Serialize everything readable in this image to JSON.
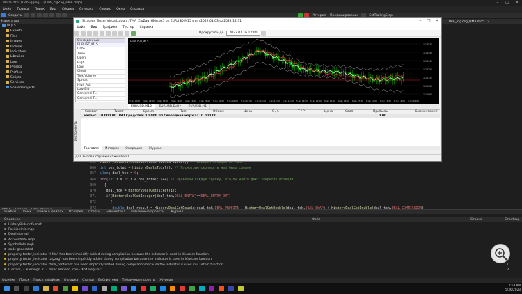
{
  "app": {
    "title": "MetaEditor (Debugging) - [TMA_ZigZag_HMA.mq5]"
  },
  "menu": [
    "Файл",
    "Правка",
    "Поиск",
    "Вид",
    "Сборка",
    "Отладка",
    "Сервис",
    "Окно",
    "Справка"
  ],
  "toolbar": {
    "new_label": "Создать",
    "compile_label": "Компилировать",
    "debug_label": "",
    "history_label": "История",
    "profile_label": "Профилирование",
    "file_label": "ExtTrailingStop"
  },
  "navigator": {
    "title": "Навигатор",
    "root": "MQL5",
    "items": [
      "Experts",
      "Files",
      "Images",
      "Include",
      "Indicators",
      "Libraries",
      "Logs",
      "Presets",
      "Profiles",
      "Scripts",
      "Services",
      "Shared Projects"
    ],
    "tabs": [
      "MQL5",
      "Проект",
      "База данных"
    ]
  },
  "editor_tab": "TMA_ZigZag_HMA.mq5",
  "code": {
    "lines": [
      {
        "n": "965",
        "parts": [
          [
            "fn",
            "HistorySelectByPosition"
          ],
          [
            "cw",
            "(last_opened_ticket); "
          ],
          [
            "cm",
            "// Выберем позицию по тикету"
          ]
        ]
      },
      {
        "n": "966",
        "parts": [
          [
            "kw",
            "int "
          ],
          [
            "cw",
            "pos_total = "
          ],
          [
            "fn",
            "HistoryDealsTotal"
          ],
          [
            "cw",
            "(); "
          ],
          [
            "cm",
            "// Посмотрим сколько в ней было сделок"
          ]
        ]
      },
      {
        "n": "967",
        "parts": [
          [
            "kw",
            "ulong "
          ],
          [
            "cw",
            "deal_tck = "
          ],
          [
            "cn",
            "0"
          ],
          [
            "cw",
            ";"
          ]
        ]
      },
      {
        "n": "968",
        "parts": [
          [
            "vb",
            "for"
          ],
          [
            "cw",
            "("
          ],
          [
            "kw",
            "int "
          ],
          [
            "cw",
            "i = "
          ],
          [
            "cn",
            "0"
          ],
          [
            "cw",
            "; i < pos_total; i++) "
          ],
          [
            "cm",
            "// Проверим каждую сделку, что-бы найти факт закрытия позиции"
          ]
        ]
      },
      {
        "n": "969",
        "parts": [
          [
            "cw",
            "  {"
          ]
        ]
      },
      {
        "n": "970",
        "parts": [
          [
            "cw",
            "   deal_tck = "
          ],
          [
            "fn",
            "HistoryDealGetTicket"
          ],
          [
            "cw",
            "(i);"
          ]
        ]
      },
      {
        "n": "971",
        "parts": [
          [
            "vb",
            "   if"
          ],
          [
            "cw",
            "("
          ],
          [
            "fn",
            "HistoryDealGetInteger"
          ],
          [
            "cw",
            "(deal_tck,"
          ],
          [
            "cn",
            "DEAL_ENTRY"
          ],
          [
            "cw",
            ")=="
          ],
          [
            "cn",
            "DEAL_ENTRY_OUT"
          ],
          [
            "cw",
            ")"
          ]
        ]
      },
      {
        "n": "972",
        "parts": [
          [
            "cw",
            "     {"
          ]
        ]
      },
      {
        "n": "973",
        "parts": [
          [
            "kw",
            "      double "
          ],
          [
            "cw",
            "deal_result = "
          ],
          [
            "fn",
            "HistoryDealGetDouble"
          ],
          [
            "cw",
            "(deal_tck,"
          ],
          [
            "cn",
            "DEAL_PROFIT"
          ],
          [
            "cw",
            ") + "
          ],
          [
            "fn",
            "HistoryDealGetDouble"
          ],
          [
            "cw",
            "(deal_tck,"
          ],
          [
            "cn",
            "DEAL_SWAP"
          ],
          [
            "cw",
            ") + "
          ],
          [
            "fn",
            "HistoryDealGetDouble"
          ],
          [
            "cw",
            "(deal_tck,"
          ],
          [
            "cn",
            "DEAL_COMMISSION"
          ],
          [
            "cw",
            ");"
          ]
        ]
      }
    ]
  },
  "tester": {
    "title": "Strategy Tester Visualization : TMA_ZigZag_HMA.ex5 on EURUSD,M15 from 2022.01.03 to 2022.12.31",
    "menu": [
      "Файл",
      "Вид",
      "Графики",
      "Тестер",
      "Справка"
    ],
    "play_label": "Прокрутить до",
    "date_value": "2022.01.16 12:00",
    "data_window": {
      "title": "Окно данных",
      "symbol": "EURUSD,M15",
      "rows": [
        "Date",
        "Time",
        "Open",
        "High",
        "Low",
        "Close",
        "Tick Volume",
        "Spread",
        "High Ask",
        "Low Bid",
        "Centered T...",
        "Centered T..."
      ]
    },
    "chart_symbol": "EURUSD,M15",
    "chart_tabs": [
      "EURUSD,M15",
      "EURUSD,Daily",
      "EURUSD,H1"
    ],
    "price_labels": [
      "1.13535",
      "1.13440",
      "1.13345",
      "1.13250",
      "1.13155",
      "1.13060",
      "1.12965"
    ],
    "time_labels": [
      "3 Jan 2022",
      "4 Jan 09:00",
      "4 Jan 13:00",
      "4 Jan 16:00",
      "4 Jan 19:00",
      "4 Jan 22:00",
      "5 Jan 01:00",
      "5 Jan 04:00",
      "5 Jan 07:00",
      "5 Jan 10:00",
      "5 Jan 13:00",
      "5 Jan 16:00",
      "5 Jan 19:00",
      "5 Jan 22:00",
      "6 Jan 01:00",
      "6 Jan 04:00",
      "6 Jan 07:00",
      "6 Jan 10:00",
      "6 Jan 13:00",
      "6 Jan 16:00",
      "7 Jan 00:00"
    ],
    "trade_headers": [
      "Символ",
      "Тикет",
      "Время",
      "Тип",
      "Объем",
      "Цена",
      "S / L",
      "T / P",
      "Цена",
      "Своп",
      "Прибыль",
      "Комментарий"
    ],
    "balance_text": "Баланс: 10 000.00 USD  Средства: 10 000.00  Свободная маржа: 10 000.00",
    "balance_profit": "0.00",
    "side_label": "Инструменты",
    "bottom_tabs": [
      "Торговля",
      "История",
      "Операции",
      "Журнал"
    ],
    "status": "Для вызова справки нажмите F1"
  },
  "mid_tabs": [
    "Ошибки",
    "Поиск",
    "Поиск в файлах",
    "Отладка",
    "Статьи",
    "Библиотека",
    "Публичные проекты",
    "Журнал"
  ],
  "errors": {
    "headers": [
      "Описание",
      "Файл",
      "Строка",
      "Столбец"
    ],
    "rows": [
      {
        "t": "HistoryOrderInfo.mqh",
        "w": false,
        "n": ""
      },
      {
        "t": "PositionInfo.mqh",
        "w": false,
        "n": ""
      },
      {
        "t": "DealInfo.mqh",
        "w": false,
        "n": ""
      },
      {
        "t": "AccountInfo.mqh",
        "w": false,
        "n": ""
      },
      {
        "t": "SymbolInfo.mqh",
        "w": false,
        "n": ""
      },
      {
        "t": "code generated",
        "w": false,
        "n": ""
      },
      {
        "t": "property tester_indicator \"HMA\" has been implicitly added during compilation because the indicator is used in iCustom function",
        "w": true,
        "n": "0"
      },
      {
        "t": "property tester_indicator \"zigzag\" has been implicitly added during compilation because the indicator is used in iCustom function",
        "w": true,
        "n": "0"
      },
      {
        "t": "property tester_indicator \"tma_centered\" has been implicitly added during compilation because the indicator is used in iCustom function",
        "w": true,
        "n": "0"
      },
      {
        "t": "0 errors, 3 warnings, 272 msec elapsed, cpu='X64 Regular'",
        "w": false,
        "n": "4"
      }
    ]
  },
  "toolbox_tabs": [
    "Ошибки",
    "Поиск",
    "Поиск в файлах",
    "Отладка",
    "Статьи",
    "Библиотека",
    "Публичные проекты",
    "Журнал"
  ],
  "clock": {
    "time": "2:54 PM",
    "date": "5/30/2023"
  },
  "colors": {
    "accent": "#0e639c",
    "folder": "#d9b04c",
    "bull": "#00c000",
    "bear": "#00c000",
    "ma_red": "#e03030",
    "ma_grey": "#aaaaaa",
    "level": "#d02020"
  }
}
